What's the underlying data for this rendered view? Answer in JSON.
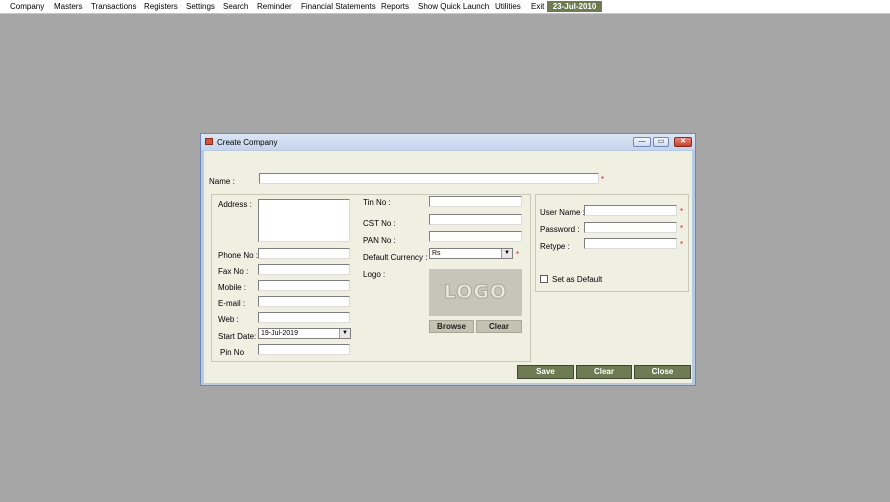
{
  "menu": {
    "items": [
      "Company",
      "Masters",
      "Transactions",
      "Registers",
      "Settings",
      "Search",
      "Reminder",
      "Financial Statements",
      "Reports",
      "Show Quick Launch",
      "Utilities",
      "Exit"
    ],
    "date": "23-Jul-2010"
  },
  "window": {
    "title": "Create Company",
    "controls": {
      "minimize": "—",
      "maximize": "▭",
      "close": "✕"
    }
  },
  "form": {
    "name_label": "Name :",
    "address_label": "Address :",
    "phone_label": "Phone No :",
    "fax_label": "Fax No :",
    "mobile_label": "Mobile :",
    "email_label": "E-mail :",
    "web_label": "Web :",
    "start_date_label": "Start Date:",
    "start_date_value": "19-Jul-2019",
    "pin_label": "Pin No",
    "tin_label": "Tin No :",
    "cst_label": "CST No :",
    "pan_label": "PAN No :",
    "currency_label": "Default Currency :",
    "currency_value": "Rs",
    "logo_label": "Logo :",
    "logo_placeholder": "LOGO",
    "browse_label": "Browse",
    "logo_clear_label": "Clear",
    "username_label": "User Name :",
    "password_label": "Password :",
    "retype_label": "Retype  :",
    "set_default_label": "Set as Default",
    "required_mark": "*"
  },
  "actions": {
    "save": "Save",
    "clear": "Clear",
    "close": "Close"
  },
  "colors": {
    "accent": "#6d7a52",
    "desktop": "#a6a6a6",
    "dialog_bg": "#efefe2",
    "required": "#e02020"
  },
  "icons": {
    "title": "app-icon",
    "dropdown": "chevron-down-icon"
  }
}
